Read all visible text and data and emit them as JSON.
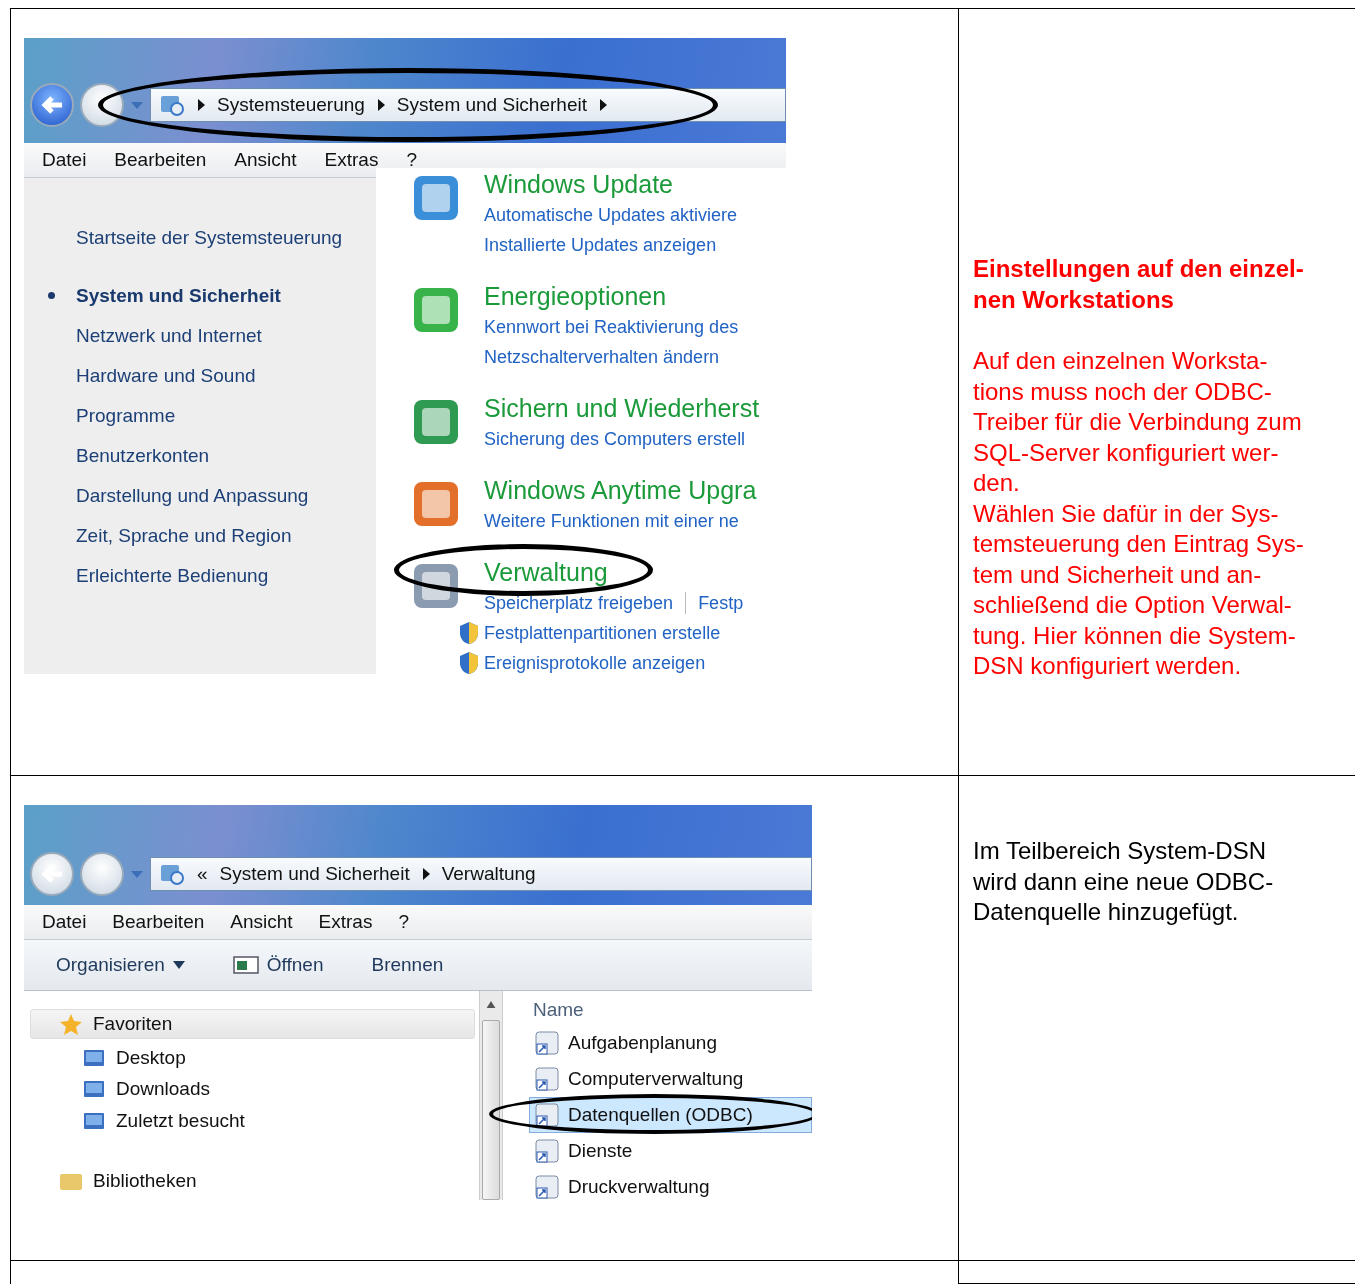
{
  "rows": [
    {
      "screenshot": {
        "kind": "control_panel",
        "address": {
          "crumbs": [
            "Systemsteuerung",
            "System und Sicherheit"
          ],
          "highlighted": true
        },
        "menu": [
          "Datei",
          "Bearbeiten",
          "Ansicht",
          "Extras",
          "?"
        ],
        "sidebar": [
          {
            "label": "Startseite der Systemsteuerung",
            "selected": false
          },
          {
            "label": "System und Sicherheit",
            "selected": true
          },
          {
            "label": "Netzwerk und Internet",
            "selected": false
          },
          {
            "label": "Hardware und Sound",
            "selected": false
          },
          {
            "label": "Programme",
            "selected": false
          },
          {
            "label": "Benutzerkonten",
            "selected": false
          },
          {
            "label": "Darstellung und Anpassung",
            "selected": false
          },
          {
            "label": "Zeit, Sprache und Region",
            "selected": false
          },
          {
            "label": "Erleichterte Bedienung",
            "selected": false
          }
        ],
        "categories": [
          {
            "title": "Windows Update",
            "highlighted": false,
            "link_rows": [
              {
                "shield": false,
                "links": [
                  "Automatische Updates aktiviere"
                ]
              },
              {
                "shield": false,
                "links": [
                  "Installierte Updates anzeigen"
                ]
              }
            ]
          },
          {
            "title": "Energieoptionen",
            "highlighted": false,
            "link_rows": [
              {
                "shield": false,
                "links": [
                  "Kennwort bei Reaktivierung des"
                ]
              },
              {
                "shield": false,
                "links": [
                  "Netzschalterverhalten ändern"
                ]
              }
            ]
          },
          {
            "title": "Sichern und Wiederherst",
            "highlighted": false,
            "link_rows": [
              {
                "shield": false,
                "links": [
                  "Sicherung des Computers erstell"
                ]
              }
            ]
          },
          {
            "title": "Windows Anytime Upgra",
            "highlighted": false,
            "link_rows": [
              {
                "shield": false,
                "links": [
                  "Weitere Funktionen mit einer ne"
                ]
              }
            ]
          },
          {
            "title": "Verwaltung",
            "highlighted": true,
            "link_rows": [
              {
                "shield": false,
                "links": [
                  "Speicherplatz freigeben",
                  "Festp"
                ]
              },
              {
                "shield": true,
                "links": [
                  "Festplattenpartitionen erstelle"
                ]
              },
              {
                "shield": true,
                "links": [
                  "Ereignisprotokolle anzeigen"
                ]
              }
            ]
          }
        ]
      },
      "note": {
        "color": "#ff0000",
        "heading": "Einstellungen auf den einzel-\nnen Workstations",
        "paragraphs": [
          "Auf den einzelnen Worksta-\ntions muss noch der ODBC-\nTreiber für die Verbindung zum\nSQL-Server konfiguriert wer-\nden.",
          "Wählen Sie dafür in der Sys-\ntemsteuerung den Eintrag Sys-\ntem und Sicherheit und an-\nschließend die Option Verwal-\ntung. Hier können die System-\nDSN konfiguriert werden."
        ]
      }
    },
    {
      "screenshot": {
        "kind": "explorer",
        "address": {
          "crumbs": [
            "«",
            "System und Sicherheit",
            "Verwaltung"
          ],
          "highlighted": false
        },
        "menu": [
          "Datei",
          "Bearbeiten",
          "Ansicht",
          "Extras",
          "?"
        ],
        "toolbar": [
          {
            "label": "Organisieren",
            "kind": "dropdown"
          },
          {
            "label": "Öffnen",
            "kind": "icon"
          },
          {
            "label": "Brennen",
            "kind": "plain"
          }
        ],
        "nav": [
          {
            "label": "Favoriten",
            "kind": "group",
            "selected": true
          },
          {
            "label": "Desktop",
            "kind": "item",
            "selected": false
          },
          {
            "label": "Downloads",
            "kind": "item",
            "selected": false
          },
          {
            "label": "Zuletzt besucht",
            "kind": "item",
            "selected": false
          },
          {
            "label": "Bibliotheken",
            "kind": "group",
            "selected": false
          }
        ],
        "column": "Name",
        "files": [
          {
            "name": "Aufgabenplanung",
            "selected": false,
            "highlighted": false
          },
          {
            "name": "Computerverwaltung",
            "selected": false,
            "highlighted": false
          },
          {
            "name": "Datenquellen (ODBC)",
            "selected": true,
            "highlighted": true
          },
          {
            "name": "Dienste",
            "selected": false,
            "highlighted": false
          },
          {
            "name": "Druckverwaltung",
            "selected": false,
            "highlighted": false
          }
        ]
      },
      "note": {
        "color": "#000000",
        "paragraphs": [
          "Im Teilbereich System-DSN\nwird dann eine neue ODBC-\nDatenquelle hinzugefügt."
        ]
      }
    },
    {}
  ]
}
